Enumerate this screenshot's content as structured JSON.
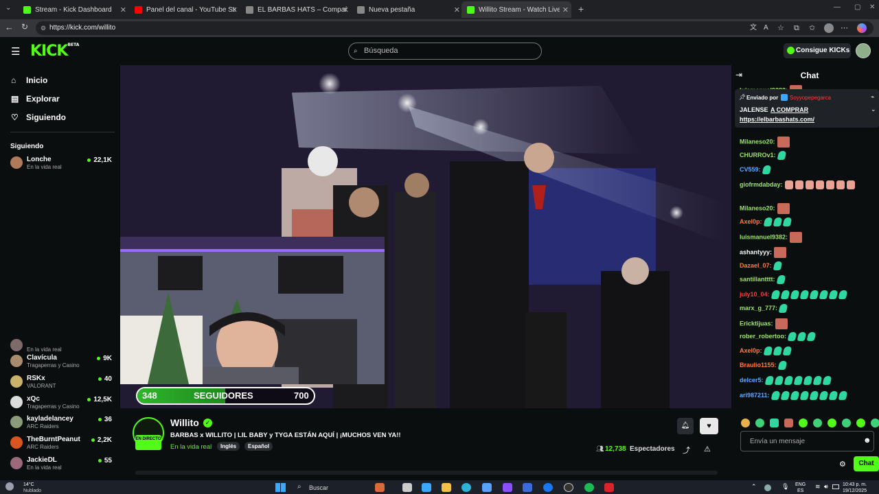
{
  "browser": {
    "tabs": [
      {
        "label": "Stream - Kick Dashboard",
        "color": "#53fc18"
      },
      {
        "label": "Panel del canal - YouTube Studio",
        "color": "#ff0000"
      },
      {
        "label": "EL BARBAS HATS – Compañía de",
        "color": "#cccccc"
      },
      {
        "label": "Nueva pestaña",
        "color": "#cccccc"
      },
      {
        "label": "Willito Stream - Watch Live o",
        "color": "#53fc18"
      }
    ],
    "url": "https://kick.com/willito"
  },
  "header": {
    "logo": "KICK",
    "logo_badge": "BETA",
    "search_placeholder": "Búsqueda",
    "kicks_button": "Consigue KICKs"
  },
  "sidebar": {
    "nav": [
      {
        "label": "Inicio",
        "icon": "home-icon"
      },
      {
        "label": "Explorar",
        "icon": "browse-icon"
      },
      {
        "label": "Siguiendo",
        "icon": "heart-icon"
      }
    ],
    "following_title": "Siguiendo",
    "following": [
      {
        "name": "Lonche",
        "sub": "En la vida real",
        "viewers": "22,1K"
      },
      {
        "name": "",
        "sub": "En la vida real",
        "viewers": ""
      },
      {
        "name": "Clavícula",
        "sub": "Tragaperras y Casino",
        "viewers": "9K"
      },
      {
        "name": "RSKx",
        "sub": "VALORANT",
        "viewers": "40"
      },
      {
        "name": "xQc",
        "sub": "Tragaperras y Casino",
        "viewers": "12,5K"
      },
      {
        "name": "kayladelancey",
        "sub": "ARC Raiders",
        "viewers": "36"
      },
      {
        "name": "TheBurntPeanut",
        "sub": "ARC Raiders",
        "viewers": "2,2K"
      },
      {
        "name": "JackieDL",
        "sub": "En la vida real",
        "viewers": "55"
      }
    ]
  },
  "overlay": {
    "current": "348",
    "label": "SEGUIDORES",
    "goal": "700",
    "progress": 0.497
  },
  "stream": {
    "channel": "Willito",
    "live_badge": "EN DIRECTO",
    "title": "BARBAS x WILLITO | LIL BABY y TYGA ESTÁN AQUÍ | ¡MUCHOS VEN YA!!",
    "category": "En la vida real",
    "tags": [
      "Inglés",
      "Español"
    ],
    "viewers": "12,738",
    "viewers_label": "Espectadores"
  },
  "chat": {
    "title": "Chat",
    "pinned_by_label": "Enviado por",
    "pinned_by_user": "Soyyopepegarca",
    "pinned_text": "JALENSE",
    "pinned_link_text": "A COMPRAR",
    "pinned_url": "https://elbarbashats.com/",
    "partial_top": "luismanuel9382:",
    "messages": [
      {
        "user": "Milaneso20:",
        "color": "#9be36a",
        "emotes": "f"
      },
      {
        "user": "CHURROv1:",
        "color": "#9be36a",
        "emotes": "g"
      },
      {
        "user": "CV559:",
        "color": "#5ea8ff",
        "emotes": "g"
      },
      {
        "user": "giofrmdabday:",
        "color": "#9be36a",
        "emotes": "hhhhhhh"
      },
      {
        "user": "Milaneso20:",
        "color": "#9be36a",
        "emotes": "f"
      },
      {
        "user": "Axel0p:",
        "color": "#ff7a3d",
        "emotes": "ggg"
      },
      {
        "user": "luismanuel9382:",
        "color": "#9be36a",
        "emotes": "f"
      },
      {
        "user": "ashantyyy:",
        "color": "#ffffff",
        "emotes": "f"
      },
      {
        "user": "Dazael_07:",
        "color": "#ff7a3d",
        "emotes": "g"
      },
      {
        "user": "santillantttt:",
        "color": "#9be36a",
        "emotes": "g"
      },
      {
        "user": "july10_04:",
        "color": "#ff3b3b",
        "emotes": "gggggggg"
      },
      {
        "user": "marx_g_777:",
        "color": "#9be36a",
        "emotes": "g"
      },
      {
        "user": "Ericktijuas:",
        "color": "#9be36a",
        "emotes": "f"
      },
      {
        "user": "rober_robertoo:",
        "color": "#9be36a",
        "emotes": "ggg"
      },
      {
        "user": "Axel0p:",
        "color": "#ff7a3d",
        "emotes": "ggg"
      },
      {
        "user": "Braulio1155:",
        "color": "#ff7a3d",
        "emotes": "g"
      },
      {
        "user": "delcer5:",
        "color": "#5ea8ff",
        "emotes": "ggggggg"
      },
      {
        "user": "ari987211:",
        "color": "#5ea8ff",
        "emotes": "gggggggg"
      }
    ],
    "input_placeholder": "Envía un mensaje",
    "send_button": "Chat"
  },
  "taskbar": {
    "weather_temp": "14°C",
    "weather_desc": "Nublado",
    "search_label": "Buscar",
    "lang": "ENG",
    "lang_sub": "ES",
    "time": "10:43 p. m.",
    "date": "19/12/2025"
  }
}
